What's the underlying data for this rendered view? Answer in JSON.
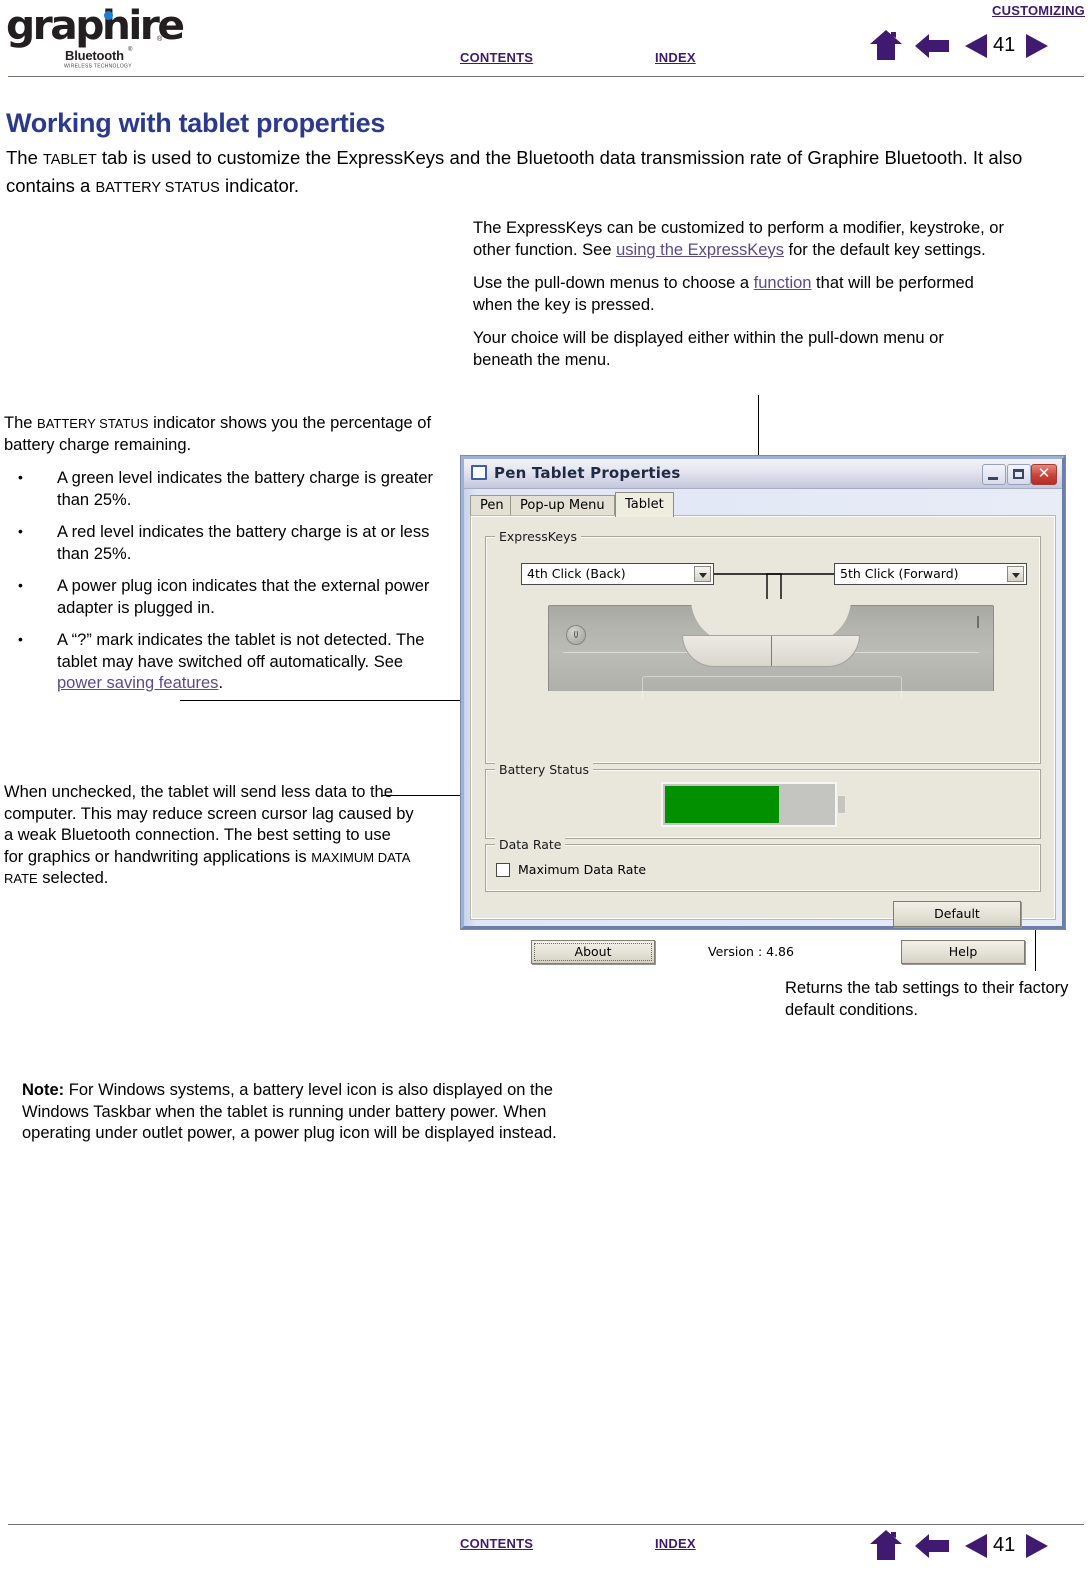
{
  "header": {
    "chapter": "CUSTOMIZING",
    "contents_label": "CONTENTS",
    "index_label": "INDEX",
    "page_number": "41",
    "logo": {
      "wordmark": "graphire",
      "sub": "Bluetooth",
      "tagline": "WIRELESS TECHNOLOGY",
      "registered": "®",
      "dot_color": "#1a7fd4"
    },
    "nav_color": "#3f1a70"
  },
  "footer": {
    "contents_label": "CONTENTS",
    "index_label": "INDEX",
    "page_number": "41"
  },
  "page": {
    "title": "Working with tablet properties",
    "title_color": "#2b3a8f",
    "intro_part1": "The ",
    "intro_sc1": "Tablet",
    "intro_part2": " tab is used to customize the ExpressKeys and the Bluetooth data transmission rate of Graphire Bluetooth.  It also contains a ",
    "intro_sc2": "Battery Status",
    "intro_part3": " indicator."
  },
  "callouts": {
    "expresskeys": {
      "p1_a": "The ExpressKeys can be customized to perform a modifier, keystroke, or other function.  See ",
      "p1_link": "using the ExpressKeys",
      "p1_b": " for the default key settings.",
      "p2_a": "Use the pull-down menus to choose a ",
      "p2_link": "function",
      "p2_b": " that will be performed when the key is pressed.",
      "p3": "Your choice will be displayed either within the pull-down menu or beneath the menu."
    },
    "battery": {
      "intro_a": "The ",
      "intro_sc": "Battery Status",
      "intro_b": " indicator shows you the percentage of battery charge remaining.",
      "bullets": [
        "A green level indicates the battery charge is greater than 25%.",
        "A red level indicates the battery charge is at or less than 25%.",
        "A power plug icon indicates that the external power adapter is plugged in."
      ],
      "bullet4_a": "A “?” mark indicates the tablet is not detected.  The tablet may have switched off automatically.  See ",
      "bullet4_link": "power saving features",
      "bullet4_b": "."
    },
    "datarate": {
      "text_a": "When unchecked, the tablet will send less data to the computer.  This may reduce screen cursor lag caused by a weak Bluetooth connection.  The best setting to use for graphics or handwriting applications is ",
      "text_sc": "Maximum Data Rate",
      "text_b": " selected."
    },
    "default_button": "Returns the tab settings to their factory default conditions.",
    "note": {
      "label": "Note:",
      "text": " For Windows systems, a battery level icon is also displayed on the Windows Taskbar when the tablet is running under battery power.  When operating under outlet power, a power plug icon will be displayed instead."
    }
  },
  "dialog": {
    "title": "Pen Tablet Properties",
    "window_buttons": {
      "minimize": "minimize-icon",
      "maximize": "maximize-icon",
      "close": "✕"
    },
    "tabs": [
      {
        "label": "Pen",
        "active": false
      },
      {
        "label": "Pop-up Menu",
        "active": false
      },
      {
        "label": "Tablet",
        "active": true
      }
    ],
    "groups": {
      "expresskeys_label": "ExpressKeys",
      "battery_label": "Battery Status",
      "datarate_label": "Data Rate"
    },
    "expresskeys": {
      "left_value": "4th Click (Back)",
      "right_value": "5th Click (Forward)"
    },
    "battery": {
      "fill_percent": 66,
      "fill_color": "#009000",
      "empty_color": "#c4c4c0"
    },
    "datarate": {
      "checkbox_label": "Maximum Data Rate",
      "checked": false
    },
    "buttons": {
      "default": "Default",
      "about": "About",
      "help": "Help"
    },
    "version_text": "Version : 4.86"
  }
}
